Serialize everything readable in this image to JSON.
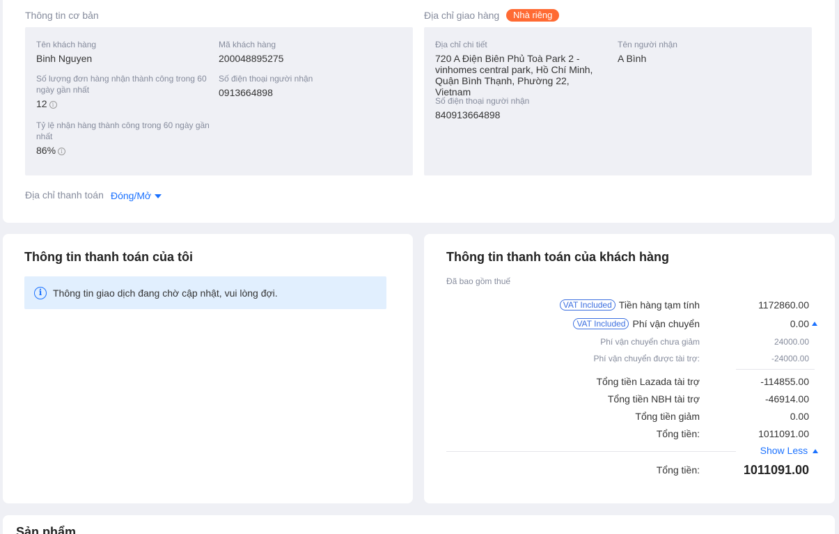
{
  "basic_info": {
    "section_label": "Thông tin cơ bản",
    "customer_name_label": "Tên khách hàng",
    "customer_name": "Binh Nguyen",
    "customer_id_label": "Mã khách hàng",
    "customer_id": "200048895275",
    "success_orders_label": "Số lượng đơn hàng nhận thành công trong 60 ngày gần nhất",
    "success_orders": "12",
    "receiver_phone_label": "Số điện thoại người nhận",
    "receiver_phone": "0913664898",
    "success_rate_label": "Tỷ lệ nhận hàng thành công trong 60 ngày gần nhất",
    "success_rate": "86%"
  },
  "shipping": {
    "section_label": "Địa chỉ giao hàng",
    "badge": "Nhà riêng",
    "address_label": "Địa chỉ chi tiết",
    "address": "720 A Điện Biên Phủ Toà Park 2 - vinhomes central park, Hồ Chí Minh, Quận Bình Thạnh, Phường 22, Vietnam",
    "receiver_name_label": "Tên người nhận",
    "receiver_name": "A Bình",
    "receiver_phone_label": "Số điện thoại người nhận",
    "receiver_phone": "840913664898"
  },
  "billing": {
    "label": "Địa chỉ thanh toán",
    "toggle": "Đóng/Mở"
  },
  "my_payment": {
    "title": "Thông tin thanh toán của tôi",
    "notice": "Thông tin giao dịch đang chờ cập nhật, vui lòng đợi."
  },
  "customer_payment": {
    "title": "Thông tin thanh toán của khách hàng",
    "tax_note": "Đã bao gồm thuế",
    "vat_badge": "VAT Included",
    "subtotal_label": "Tiền hàng tạm tính",
    "subtotal": "1172860.00",
    "shipping_label": "Phí vận chuyển",
    "shipping": "0.00",
    "shipping_original_label": "Phí vận chuyển chưa giảm",
    "shipping_original": "24000.00",
    "shipping_sponsored_label": "Phí vận chuyển được tài trợ:",
    "shipping_sponsored": "-24000.00",
    "lazada_sponsor_label": "Tổng tiền Lazada tài trợ",
    "lazada_sponsor": "-114855.00",
    "seller_sponsor_label": "Tổng tiền NBH tài trợ",
    "seller_sponsor": "-46914.00",
    "discount_label": "Tổng tiền giảm",
    "discount": "0.00",
    "total_label": "Tổng tiền:",
    "total": "1011091.00",
    "show_less": "Show Less",
    "grand_total_label": "Tổng tiền:",
    "grand_total": "1011091.00"
  },
  "products": {
    "title": "Sản phẩm"
  }
}
